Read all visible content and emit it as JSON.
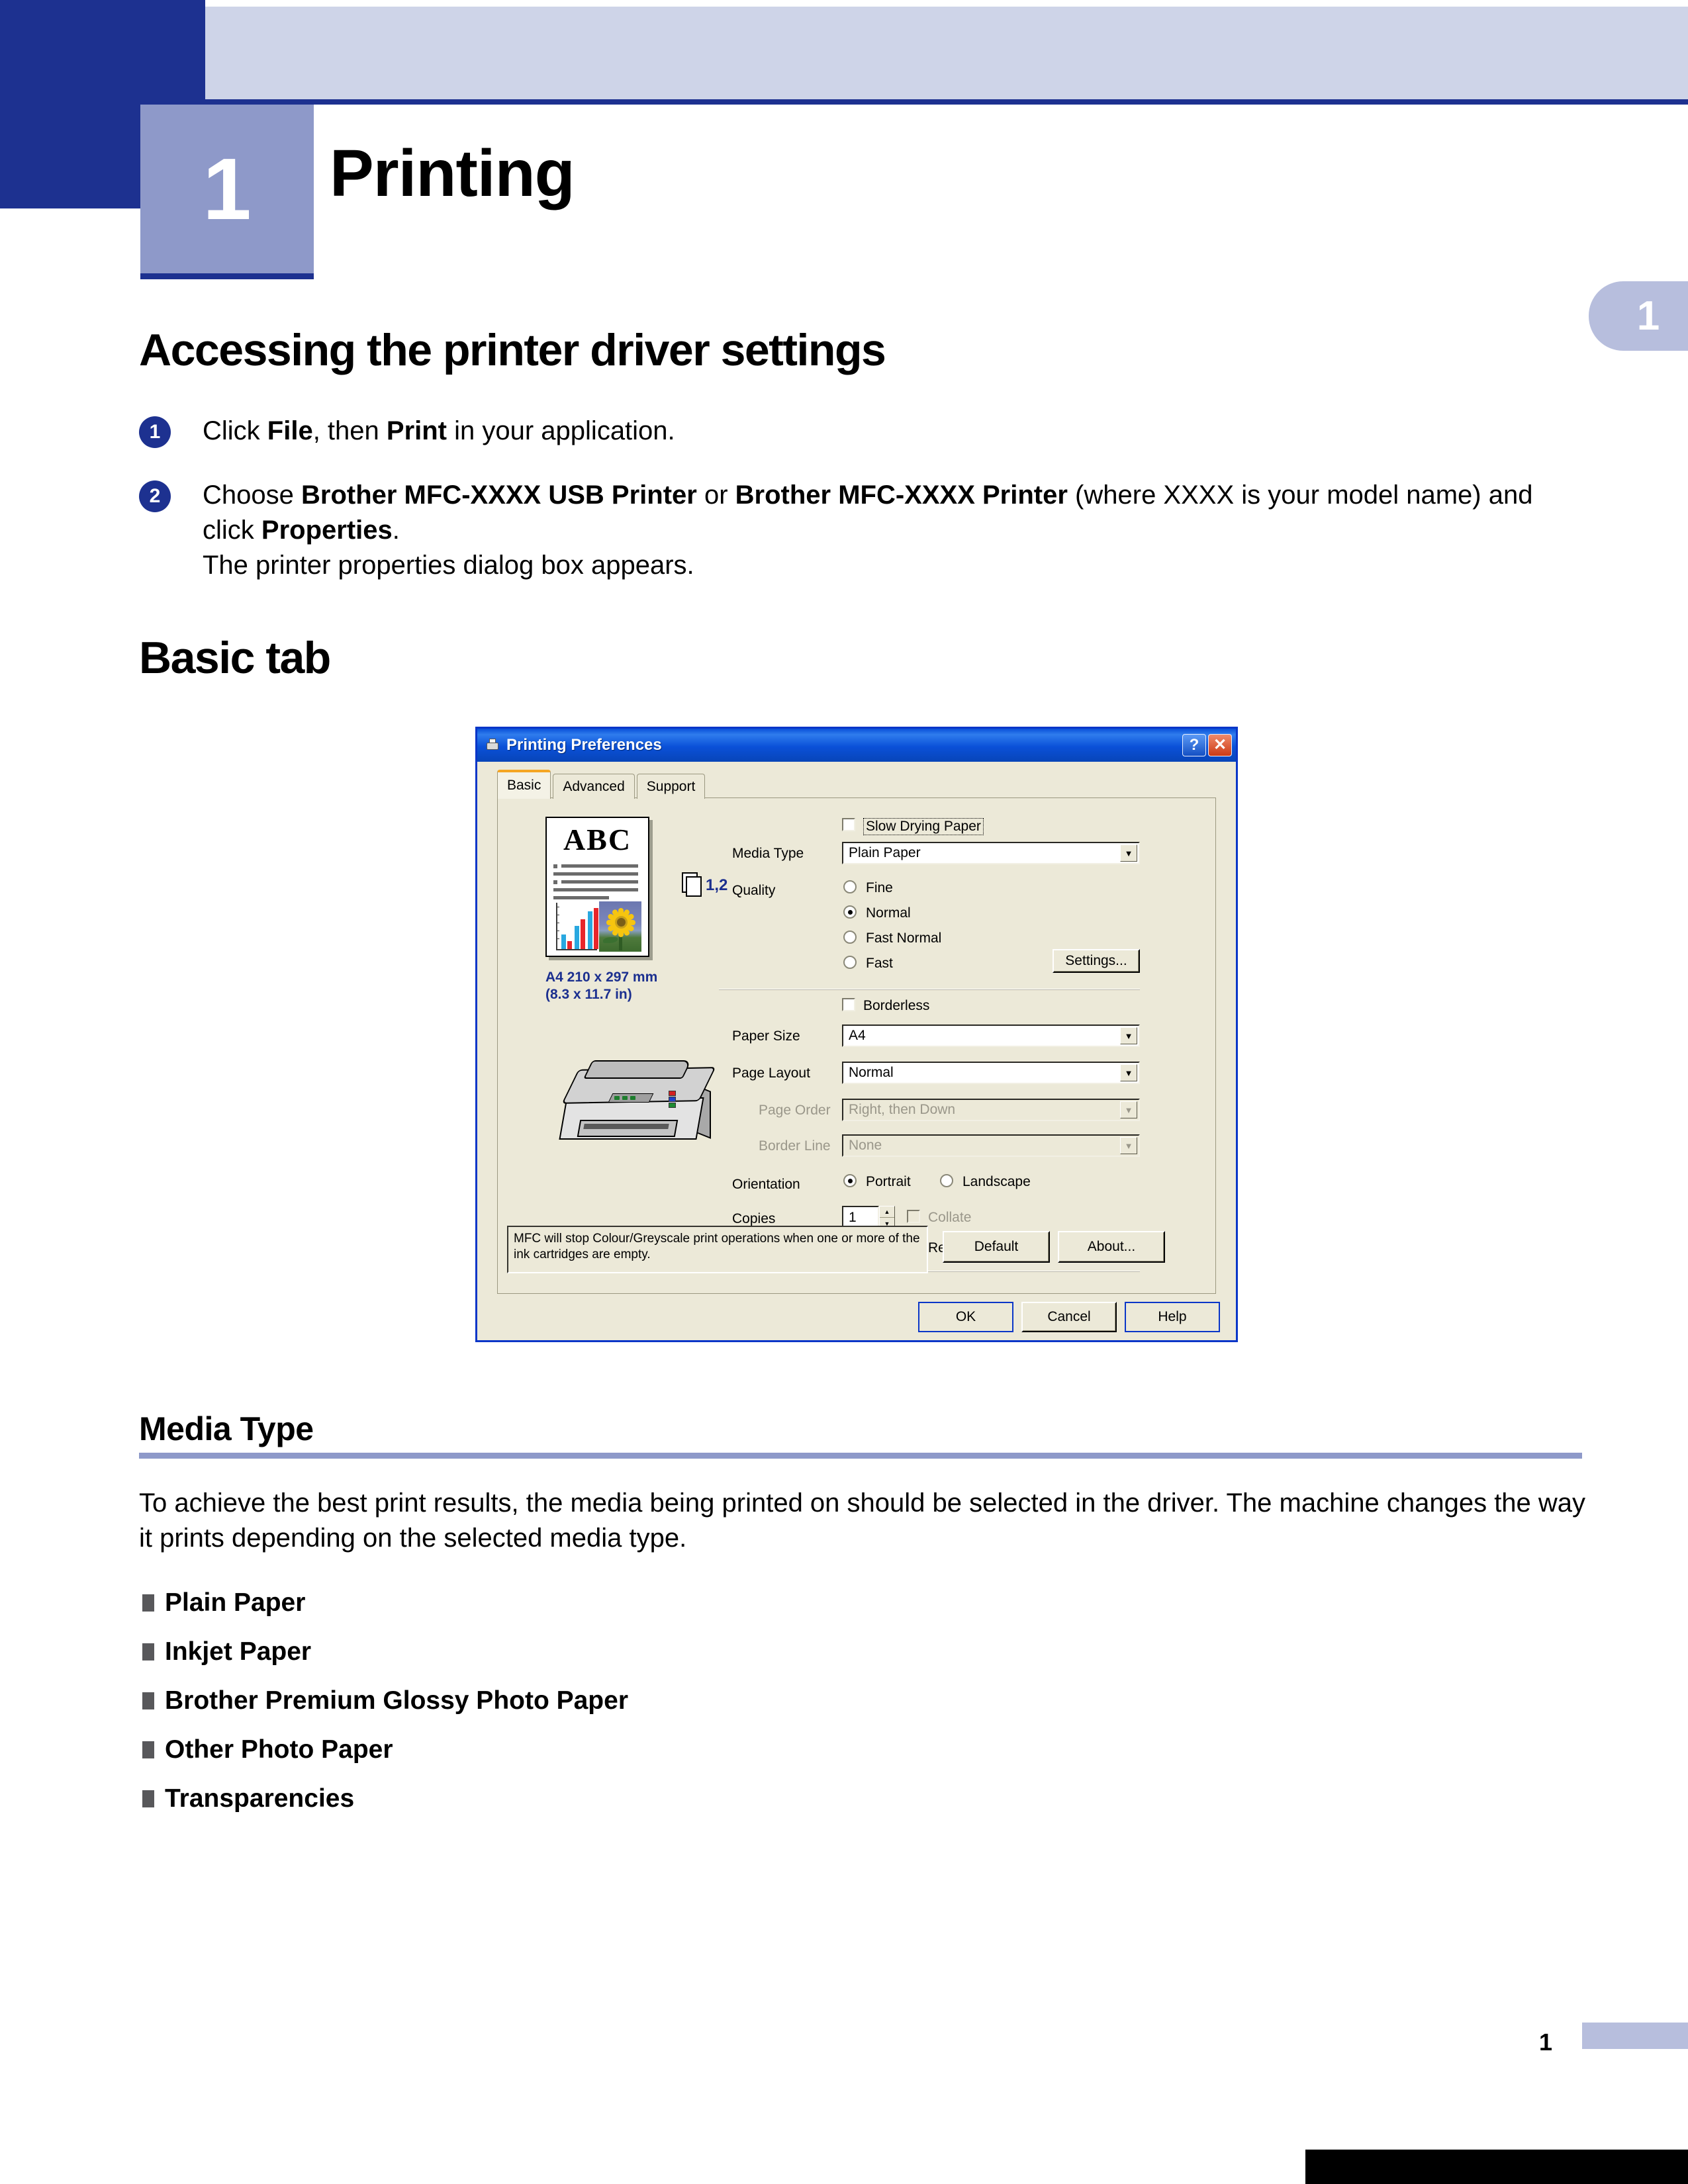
{
  "chapter": {
    "number": "1",
    "title": "Printing",
    "side_tab": "1"
  },
  "sections": {
    "accessing_title": "Accessing the printer driver settings",
    "basic_tab_title": "Basic tab",
    "media_type_title": "Media Type"
  },
  "steps": [
    {
      "num": "1",
      "html": "Click <b>File</b>, then <b>Print</b> in your application."
    },
    {
      "num": "2",
      "html": "Choose <b>Brother MFC-XXXX USB Printer</b> or <b>Brother MFC-XXXX Printer</b> (where XXXX is your model name) and click <b>Properties</b>.<br>The printer properties dialog box appears."
    }
  ],
  "media_type": {
    "paragraph": "To achieve the best print results, the media being printed on should be selected in the driver. The machine changes the way it prints depending on the selected media type.",
    "bullets": [
      "Plain Paper",
      "Inkjet Paper",
      "Brother Premium Glossy Photo Paper",
      "Other Photo Paper",
      "Transparencies"
    ]
  },
  "footer": {
    "page_number": "1"
  },
  "dialog": {
    "title": "Printing Preferences",
    "help_button": "?",
    "close_button": "✕",
    "tabs": [
      {
        "label": "Basic",
        "active": true
      },
      {
        "label": "Advanced",
        "active": false
      },
      {
        "label": "Support",
        "active": false
      }
    ],
    "preview": {
      "doc_heading": "ABC",
      "copies_badge": "1,2",
      "paper_info_line1": "A4 210 x 297 mm",
      "paper_info_line2": "(8.3 x 11.7 in)"
    },
    "controls": {
      "slow_drying_paper_label": "Slow Drying Paper",
      "slow_drying_paper_checked": false,
      "media_type_label": "Media Type",
      "media_type_value": "Plain Paper",
      "quality_label": "Quality",
      "quality_options": [
        "Fine",
        "Normal",
        "Fast Normal",
        "Fast"
      ],
      "quality_selected": "Normal",
      "settings_button": "Settings...",
      "borderless_label": "Borderless",
      "borderless_checked": false,
      "paper_size_label": "Paper Size",
      "paper_size_value": "A4",
      "page_layout_label": "Page Layout",
      "page_layout_value": "Normal",
      "page_order_label": "Page Order",
      "page_order_value": "Right, then Down",
      "page_order_disabled": true,
      "border_line_label": "Border Line",
      "border_line_value": "None",
      "border_line_disabled": true,
      "orientation_label": "Orientation",
      "orientation_options": [
        "Portrait",
        "Landscape"
      ],
      "orientation_selected": "Portrait",
      "copies_label": "Copies",
      "copies_value": "1",
      "collate_label": "Collate",
      "collate_checked": false,
      "collate_disabled": true,
      "reverse_order_label": "Reverse Order",
      "reverse_order_checked": false
    },
    "status_message": "MFC will stop Colour/Greyscale print operations when one or more of the ink cartridges are empty.",
    "buttons": {
      "default": "Default",
      "about": "About...",
      "ok": "OK",
      "cancel": "Cancel",
      "help": "Help"
    }
  },
  "colors": {
    "deep_blue": "#1d3190",
    "header_lavender": "#ced4e8",
    "chapter_block": "#8e99c9",
    "rule_lavender": "#8e99c9",
    "dialog_face": "#ece9d8",
    "titlebar_blue": "#0a50d8",
    "preview_text_blue": "#1b2f8f"
  }
}
